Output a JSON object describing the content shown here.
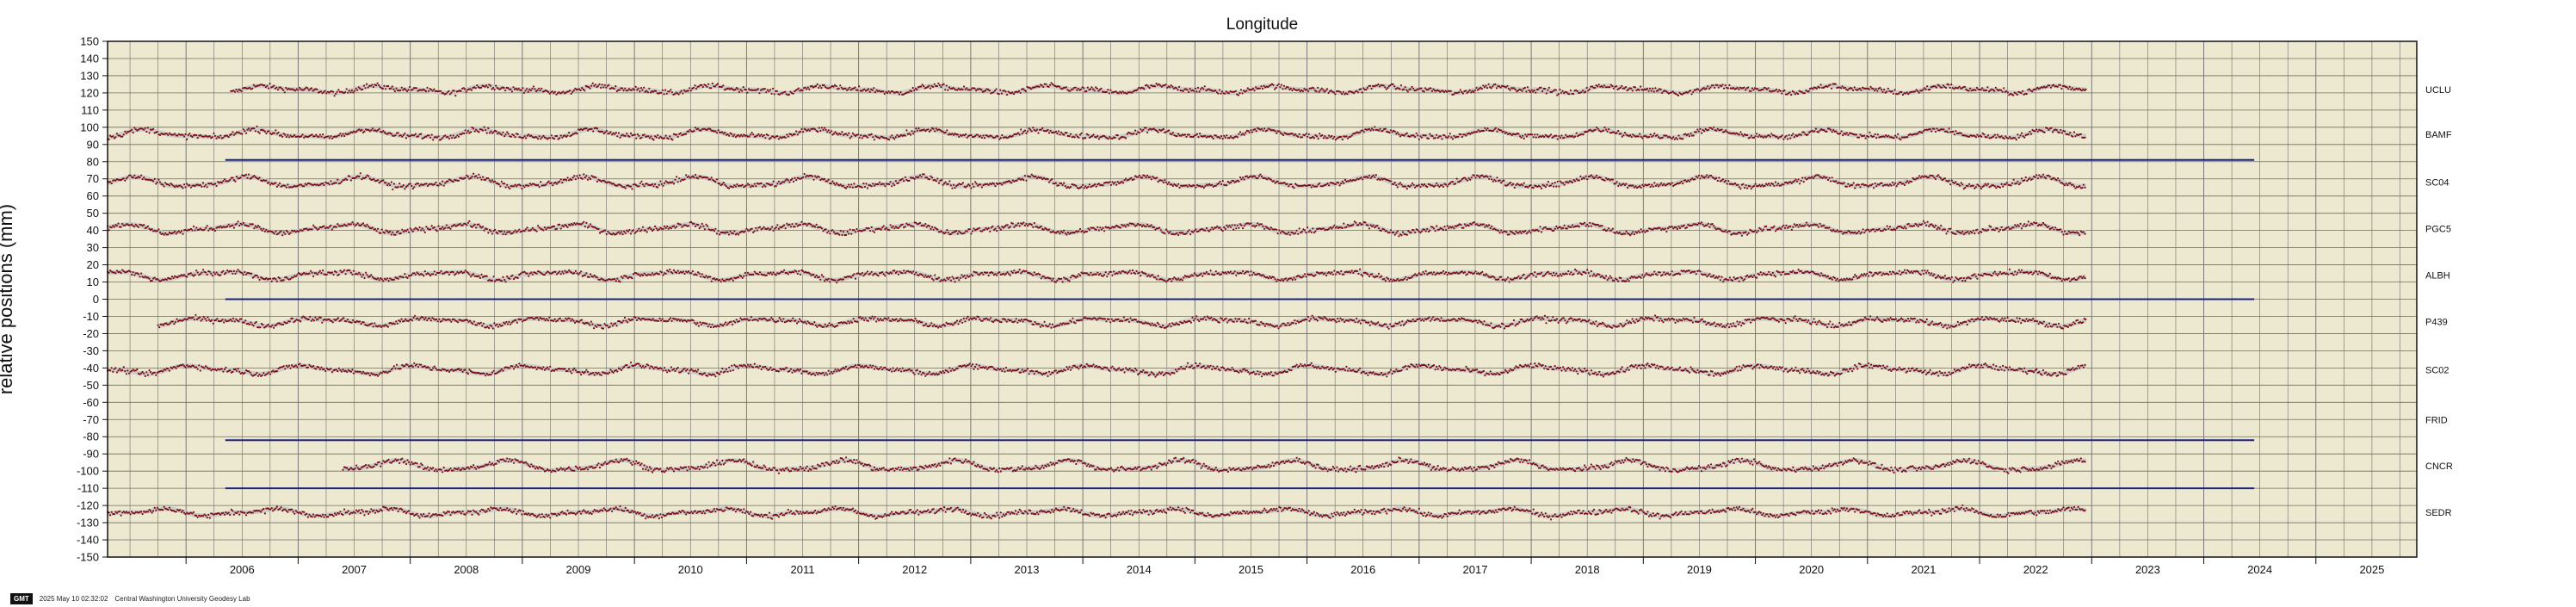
{
  "chart_data": {
    "type": "scatter",
    "title": "Longitude",
    "ylabel": "relative positions (mm)",
    "xlabel": "",
    "xlim": [
      2005.3,
      2025.9
    ],
    "ylim": [
      -150,
      150
    ],
    "y_ticks": [
      150,
      140,
      130,
      120,
      110,
      100,
      90,
      80,
      70,
      60,
      50,
      40,
      30,
      20,
      10,
      0,
      -10,
      -20,
      -30,
      -40,
      -50,
      -60,
      -70,
      -80,
      -90,
      -100,
      -110,
      -120,
      -130,
      -140,
      -150
    ],
    "x_ticks": [
      "2006",
      "2007",
      "2008",
      "2009",
      "2010",
      "2011",
      "2012",
      "2013",
      "2014",
      "2015",
      "2016",
      "2017",
      "2018",
      "2019",
      "2020",
      "2021",
      "2022",
      "2023",
      "2024",
      "2025"
    ],
    "grid": true,
    "background_color": "#ede8d0",
    "grid_color": "#6d6d6d",
    "point_color": "#7a1015",
    "model_color": "#c9c9c9",
    "reference_line_color": "#1a237e",
    "series": [
      {
        "name": "UCLU",
        "offset": 122,
        "start": 2006.4,
        "end": 2022.95,
        "amp": 1.6
      },
      {
        "name": "BAMF",
        "offset": 96,
        "start": 2005.3,
        "end": 2022.95,
        "amp": 2.0
      },
      {
        "name": "SC04",
        "offset": 68,
        "start": 2005.3,
        "end": 2022.95,
        "amp": 2.6
      },
      {
        "name": "PGC5",
        "offset": 41,
        "start": 2005.3,
        "end": 2022.95,
        "amp": 2.2
      },
      {
        "name": "ALBH",
        "offset": 14,
        "start": 2005.3,
        "end": 2022.95,
        "amp": 2.0
      },
      {
        "name": "P439",
        "offset": -13,
        "start": 2005.75,
        "end": 2022.95,
        "amp": 1.8
      },
      {
        "name": "SC02",
        "offset": -41,
        "start": 2005.3,
        "end": 2022.95,
        "amp": 2.0
      },
      {
        "name": "FRID",
        "offset": -70,
        "start": null,
        "end": null,
        "amp": 0
      },
      {
        "name": "CNCR",
        "offset": -97,
        "start": 2007.4,
        "end": 2022.95,
        "amp": 2.6
      },
      {
        "name": "SEDR",
        "offset": -124,
        "start": 2005.3,
        "end": 2022.95,
        "amp": 1.6
      }
    ],
    "reference_lines": [
      {
        "y": 81,
        "x_start": 2006.35,
        "x_end": 2024.45
      },
      {
        "y": 0,
        "x_start": 2006.35,
        "x_end": 2024.45
      },
      {
        "y": -82,
        "x_start": 2006.35,
        "x_end": 2024.45
      },
      {
        "y": -110,
        "x_start": 2006.35,
        "x_end": 2024.45
      }
    ]
  },
  "footer": {
    "logo": "GMT",
    "timestamp": "2025 May 10 02:32:02",
    "credit": "Central Washington University Geodesy Lab"
  }
}
